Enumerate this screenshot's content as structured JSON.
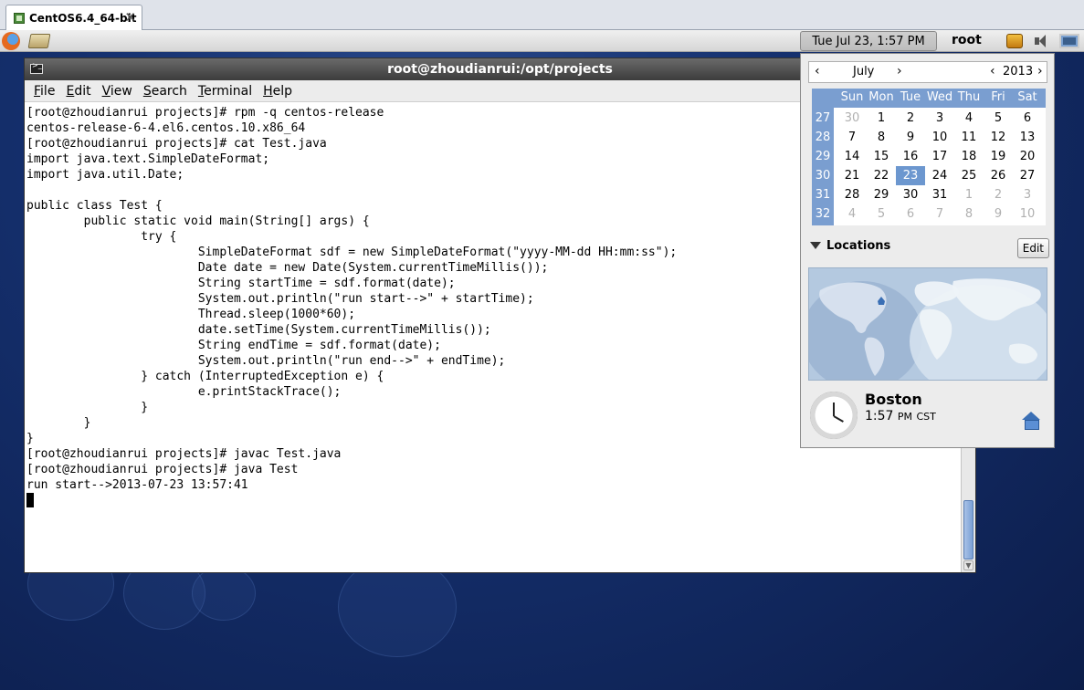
{
  "vm": {
    "tab_title": "CentOS6.4_64-bit",
    "close_glyph": "✕"
  },
  "panel": {
    "clock": "Tue Jul 23,  1:57 PM",
    "user": "root",
    "icons": [
      "firefox-icon",
      "launcher-icon",
      "update-icon",
      "volume-icon",
      "network-icon"
    ]
  },
  "terminal": {
    "title": "root@zhoudianrui:/opt/projects",
    "menu": [
      "File",
      "Edit",
      "View",
      "Search",
      "Terminal",
      "Help"
    ],
    "lines": [
      "[root@zhoudianrui projects]# rpm -q centos-release",
      "centos-release-6-4.el6.centos.10.x86_64",
      "[root@zhoudianrui projects]# cat Test.java",
      "import java.text.SimpleDateFormat;",
      "import java.util.Date;",
      "",
      "public class Test {",
      "        public static void main(String[] args) {",
      "                try {",
      "                        SimpleDateFormat sdf = new SimpleDateFormat(\"yyyy-MM-dd HH:mm:ss\");",
      "                        Date date = new Date(System.currentTimeMillis());",
      "                        String startTime = sdf.format(date);",
      "                        System.out.println(\"run start-->\" + startTime);",
      "                        Thread.sleep(1000*60);",
      "                        date.setTime(System.currentTimeMillis());",
      "                        String endTime = sdf.format(date);",
      "                        System.out.println(\"run end-->\" + endTime);",
      "                } catch (InterruptedException e) {",
      "                        e.printStackTrace();",
      "                }",
      "        }",
      "}",
      "[root@zhoudianrui projects]# javac Test.java",
      "[root@zhoudianrui projects]# java Test",
      "run start-->2013-07-23 13:57:41"
    ]
  },
  "calendar": {
    "month": "July",
    "year": "2013",
    "prev": "‹",
    "next": "›",
    "day_headers": [
      "Sun",
      "Mon",
      "Tue",
      "Wed",
      "Thu",
      "Fri",
      "Sat"
    ],
    "weeks": [
      {
        "num": "27",
        "days": [
          {
            "d": "30",
            "other": true
          },
          {
            "d": "1"
          },
          {
            "d": "2"
          },
          {
            "d": "3"
          },
          {
            "d": "4"
          },
          {
            "d": "5"
          },
          {
            "d": "6"
          }
        ]
      },
      {
        "num": "28",
        "days": [
          {
            "d": "7"
          },
          {
            "d": "8"
          },
          {
            "d": "9"
          },
          {
            "d": "10"
          },
          {
            "d": "11"
          },
          {
            "d": "12"
          },
          {
            "d": "13"
          }
        ]
      },
      {
        "num": "29",
        "days": [
          {
            "d": "14"
          },
          {
            "d": "15"
          },
          {
            "d": "16"
          },
          {
            "d": "17"
          },
          {
            "d": "18"
          },
          {
            "d": "19"
          },
          {
            "d": "20"
          }
        ]
      },
      {
        "num": "30",
        "days": [
          {
            "d": "21"
          },
          {
            "d": "22"
          },
          {
            "d": "23",
            "today": true
          },
          {
            "d": "24"
          },
          {
            "d": "25"
          },
          {
            "d": "26"
          },
          {
            "d": "27"
          }
        ]
      },
      {
        "num": "31",
        "days": [
          {
            "d": "28"
          },
          {
            "d": "29"
          },
          {
            "d": "30"
          },
          {
            "d": "31"
          },
          {
            "d": "1",
            "other": true
          },
          {
            "d": "2",
            "other": true
          },
          {
            "d": "3",
            "other": true
          }
        ]
      },
      {
        "num": "32",
        "days": [
          {
            "d": "4",
            "other": true
          },
          {
            "d": "5",
            "other": true
          },
          {
            "d": "6",
            "other": true
          },
          {
            "d": "7",
            "other": true
          },
          {
            "d": "8",
            "other": true
          },
          {
            "d": "9",
            "other": true
          },
          {
            "d": "10",
            "other": true
          }
        ]
      }
    ],
    "accent_color": "#7a9ed0",
    "today_color": "#6c97cf"
  },
  "locations": {
    "label": "Locations",
    "edit_label": "Edit",
    "city": "Boston",
    "time": "1:57",
    "ampm": "PM",
    "zone": "CST"
  }
}
